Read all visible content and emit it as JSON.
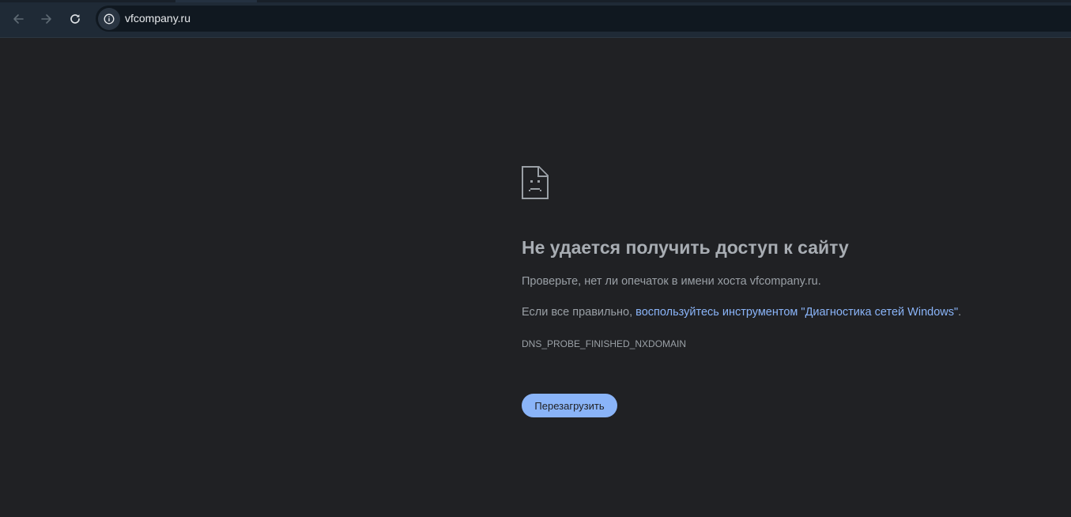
{
  "toolbar": {
    "back_icon": "arrow-left-icon",
    "forward_icon": "arrow-right-icon",
    "reload_icon": "reload-icon",
    "site_info_icon": "info-circle-icon",
    "url": "vfcompany.ru"
  },
  "error_page": {
    "icon": "sad-document-icon",
    "title": "Не удается получить доступ к сайту",
    "check_text": "Проверьте, нет ли опечаток в имени хоста vfcompany.ru.",
    "if_correct_prefix": "Если все правильно, ",
    "diagnostics_link": "воспользуйтесь инструментом \"Диагностика сетей Windows\"",
    "if_correct_suffix": ".",
    "error_code": "DNS_PROBE_FINISHED_NXDOMAIN",
    "reload_button": "Перезагрузить"
  },
  "colors": {
    "page_background": "#202124",
    "toolbar_background": "#1f2a36",
    "omnibox_background": "#101820",
    "link": "#8ab4f8",
    "button_background": "#8ab4f8",
    "text": "#9aa0a6"
  }
}
